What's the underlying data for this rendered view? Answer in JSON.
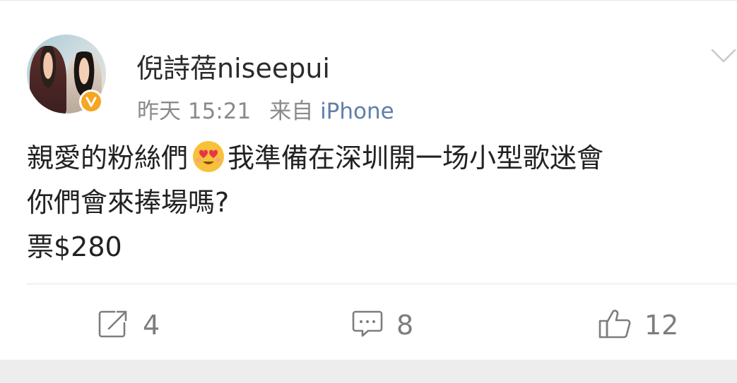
{
  "post": {
    "username": "倪詩蓓niseepui",
    "timestamp": "昨天 15:21",
    "source_prefix": "来自",
    "source_device": "iPhone",
    "verified_icon": "vip-v-badge-icon",
    "avatar_icon": "couple-photo-avatar",
    "text": {
      "line1_before_emoji": "親愛的粉絲們",
      "emoji_icon": "heart-eyes-emoji",
      "line1_after_emoji": "我準備在深圳開一场小型歌迷會",
      "line2": "你們會來捧場嗎?",
      "line3": "票$280"
    }
  },
  "actions": {
    "repost": {
      "icon": "repost-icon",
      "count": "4"
    },
    "comment": {
      "icon": "comment-icon",
      "count": "8"
    },
    "like": {
      "icon": "thumbs-up-icon",
      "count": "12"
    }
  },
  "menu": {
    "icon": "chevron-down-icon"
  },
  "colors": {
    "username": "#2b2b2b",
    "meta": "#8a8a8a",
    "source_link": "#5f7fa8",
    "verified_badge": "#f5a623",
    "action_icon": "#7d7d7d",
    "background": "#ededed",
    "card": "#ffffff"
  }
}
